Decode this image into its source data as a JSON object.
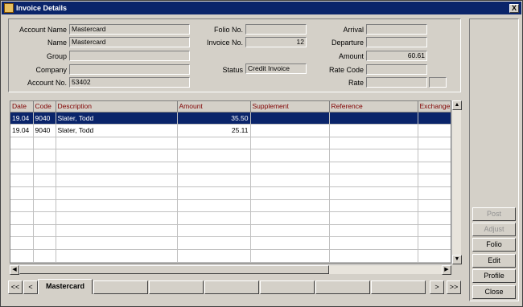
{
  "window": {
    "title": "Invoice Details",
    "close_glyph": "X"
  },
  "labels": {
    "account_name": "Account Name",
    "name": "Name",
    "group": "Group",
    "company": "Company",
    "account_no": "Account No.",
    "folio_no": "Folio No.",
    "invoice_no": "Invoice No.",
    "status": "Status",
    "arrival": "Arrival",
    "departure": "Departure",
    "amount": "Amount",
    "rate_code": "Rate Code",
    "rate": "Rate"
  },
  "values": {
    "account_name": "Mastercard",
    "name": "Mastercard",
    "group": "",
    "company": "",
    "account_no": "53402",
    "folio_no": "",
    "invoice_no": "12",
    "status": "Credit Invoice",
    "arrival": "",
    "departure": "",
    "amount": "60.61",
    "rate_code": "",
    "rate": "",
    "rate_extra": ""
  },
  "grid": {
    "columns": [
      "Date",
      "Code",
      "Description",
      "Amount",
      "Supplement",
      "Reference",
      "Exchange"
    ],
    "rows": [
      [
        "19.04",
        "9040",
        "Slater, Todd",
        "35.50",
        "",
        "",
        ""
      ],
      [
        "19.04",
        "9040",
        "Slater, Todd",
        "25.11",
        "",
        "",
        ""
      ]
    ],
    "selected_row": 0
  },
  "buttons": {
    "post": "Post",
    "adjust": "Adjust",
    "folio": "Folio",
    "edit": "Edit",
    "profile": "Profile",
    "close": "Close"
  },
  "tabs": {
    "first": "<<",
    "prev": "<",
    "active": "Mastercard",
    "next": ">",
    "last": ">>"
  }
}
